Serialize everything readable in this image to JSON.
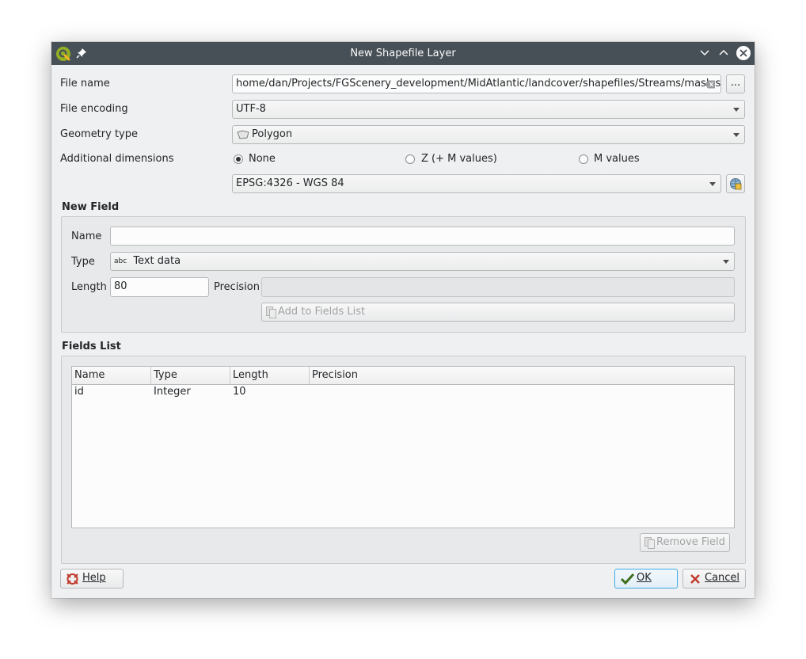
{
  "window": {
    "title": "New Shapefile Layer"
  },
  "form": {
    "file_name_label": "File name",
    "file_name_value": "home/dan/Projects/FGScenery_development/MidAtlantic/landcover/shapefiles/Streams/mask.shp",
    "browse_label": "...",
    "file_encoding_label": "File encoding",
    "file_encoding_value": "UTF-8",
    "geometry_type_label": "Geometry type",
    "geometry_type_value": "Polygon",
    "additional_dimensions_label": "Additional dimensions",
    "dim_none": "None",
    "dim_z": "Z (+ M values)",
    "dim_m": "M values",
    "crs_value": "EPSG:4326 - WGS 84"
  },
  "new_field": {
    "title": "New Field",
    "name_label": "Name",
    "name_value": "",
    "type_label": "Type",
    "type_icon_text": "abc",
    "type_value": "Text data",
    "length_label": "Length",
    "length_value": "80",
    "precision_label": "Precision",
    "precision_value": "",
    "add_button": "Add to Fields List"
  },
  "fields_list": {
    "title": "Fields List",
    "columns": [
      "Name",
      "Type",
      "Length",
      "Precision"
    ],
    "rows": [
      {
        "name": "id",
        "type": "Integer",
        "length": "10",
        "precision": ""
      }
    ],
    "remove_button": "Remove Field"
  },
  "buttons": {
    "help": "Help",
    "ok": "OK",
    "cancel": "Cancel"
  },
  "colors": {
    "titlebar": "#475057",
    "accent": "#3daee9",
    "qgis_green": "#589632"
  }
}
